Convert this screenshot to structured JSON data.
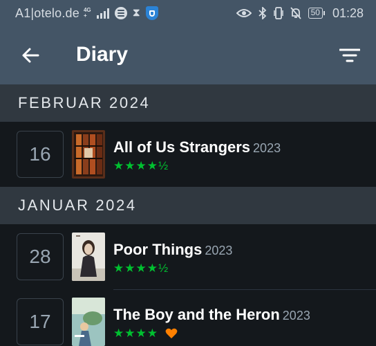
{
  "status_bar": {
    "carrier": "A1|otelo.de",
    "network_top": "4G",
    "network_bottom": "+",
    "battery": "50",
    "time": "01:28"
  },
  "header": {
    "title": "Diary",
    "back_icon": "arrow-left-icon",
    "filter_icon": "filter-icon"
  },
  "sections": [
    {
      "label": "FEBRUAR 2024",
      "entries": [
        {
          "day": "16",
          "title": "All of Us Strangers",
          "year": "2023",
          "rating": "★★★★½",
          "liked": false
        }
      ]
    },
    {
      "label": "JANUAR 2024",
      "entries": [
        {
          "day": "28",
          "title": "Poor Things",
          "year": "2023",
          "rating": "★★★★½",
          "liked": false
        },
        {
          "day": "17",
          "title": "The Boy and the Heron",
          "year": "2023",
          "rating": "★★★★",
          "liked": true
        }
      ]
    }
  ],
  "colors": {
    "app_bar": "#445566",
    "background": "#14181c",
    "section_header": "#303840",
    "star": "#00c030",
    "heart": "#ff8000"
  }
}
